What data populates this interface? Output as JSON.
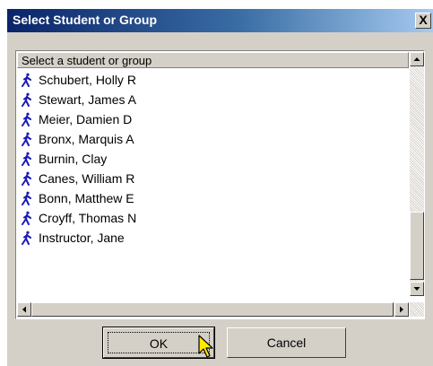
{
  "dialog": {
    "title": "Select Student or Group",
    "close_symbol": "X"
  },
  "list": {
    "header": "Select a student or group",
    "item_icon": "student-figure-icon",
    "items": [
      "Schubert, Holly R",
      "Stewart, James A",
      "Meier, Damien D",
      "Bronx, Marquis A",
      "Burnin, Clay",
      "Canes, William R",
      "Bonn, Matthew E",
      "Croyff, Thomas N",
      "Instructor, Jane"
    ]
  },
  "buttons": {
    "ok": "OK",
    "cancel": "Cancel"
  },
  "colors": {
    "titlebar_start": "#0a246a",
    "titlebar_end": "#a6caf0",
    "icon": "#1a1ab4",
    "face": "#d4d0c8"
  }
}
